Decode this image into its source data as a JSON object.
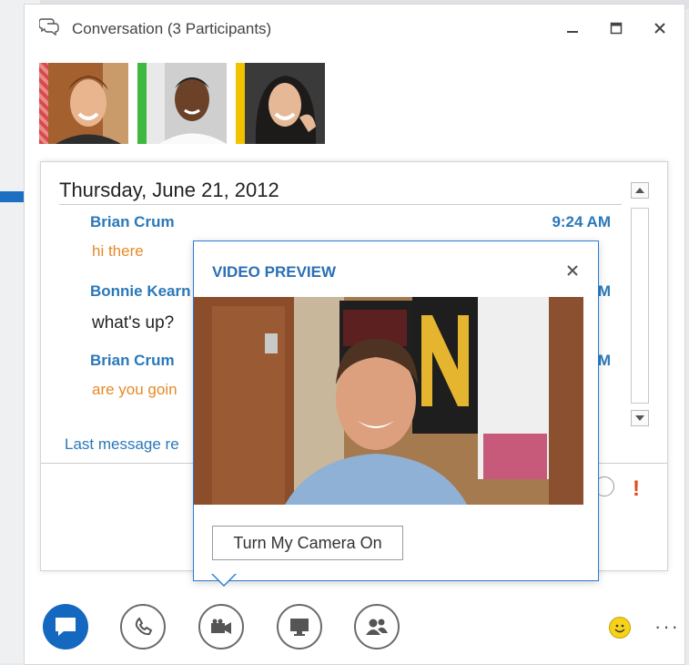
{
  "window": {
    "title": "Conversation (3 Participants)",
    "minimize_label": "–",
    "maximize_label": "☐",
    "close_label": "✕"
  },
  "participants": [
    {
      "name": "participant-1",
      "status_color": "#d94a4a"
    },
    {
      "name": "participant-2",
      "status_color": "#3fb83f"
    },
    {
      "name": "participant-3",
      "status_color": "#f2c200"
    }
  ],
  "chat": {
    "date": "Thursday, June 21, 2012",
    "messages": [
      {
        "sender": "Brian Crum",
        "time": "9:24 AM",
        "text": "hi there"
      },
      {
        "sender": "Bonnie Kearn",
        "time": "M",
        "text": "what's up?"
      },
      {
        "sender": "Brian Crum",
        "time": "M",
        "text": "are you goin"
      }
    ],
    "status_text": "Last message re"
  },
  "video_preview": {
    "title": "VIDEO PREVIEW",
    "close_label": "✕",
    "button_label": "Turn My Camera On"
  },
  "toolbar": {
    "items": [
      {
        "name": "im-button",
        "icon": "chat-bubble-icon",
        "active": true
      },
      {
        "name": "call-button",
        "icon": "phone-icon"
      },
      {
        "name": "video-button",
        "icon": "video-camera-icon"
      },
      {
        "name": "present-button",
        "icon": "monitor-icon"
      },
      {
        "name": "participants-button",
        "icon": "people-icon"
      }
    ],
    "more_label": "···"
  },
  "colors": {
    "accent": "#1568bf",
    "link": "#2a78b9",
    "message_orange": "#e58a28",
    "alert": "#e24b1b"
  }
}
